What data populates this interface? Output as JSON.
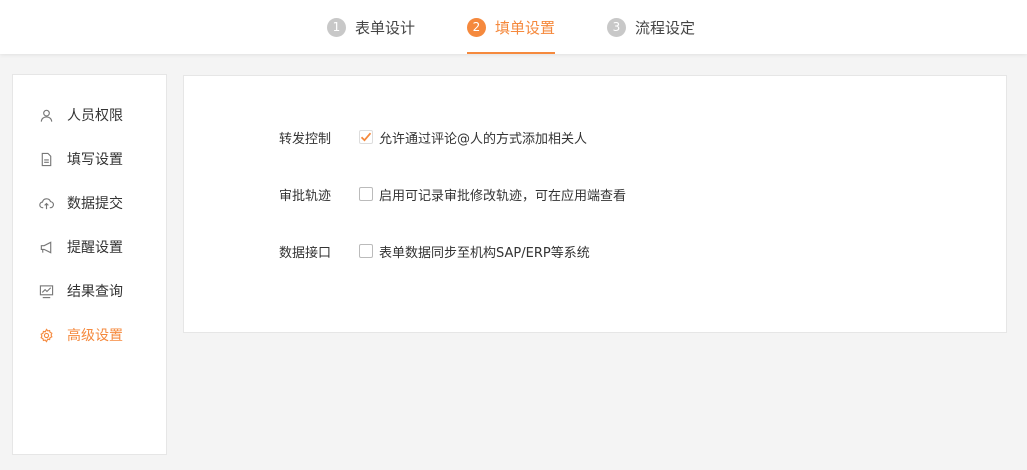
{
  "steps": [
    {
      "num": "1",
      "label": "表单设计",
      "active": false
    },
    {
      "num": "2",
      "label": "填单设置",
      "active": true
    },
    {
      "num": "3",
      "label": "流程设定",
      "active": false
    }
  ],
  "sidebar": {
    "items": [
      {
        "label": "人员权限",
        "icon": "user-icon"
      },
      {
        "label": "填写设置",
        "icon": "document-icon"
      },
      {
        "label": "数据提交",
        "icon": "cloud-upload-icon"
      },
      {
        "label": "提醒设置",
        "icon": "megaphone-icon"
      },
      {
        "label": "结果查询",
        "icon": "chart-monitor-icon"
      },
      {
        "label": "高级设置",
        "icon": "gear-icon",
        "active": true
      }
    ]
  },
  "settings": {
    "rows": [
      {
        "label": "转发控制",
        "text": "允许通过评论@人的方式添加相关人",
        "checked": true
      },
      {
        "label": "审批轨迹",
        "text": "启用可记录审批修改轨迹，可在应用端查看",
        "checked": false
      },
      {
        "label": "数据接口",
        "text": "表单数据同步至机构SAP/ERP等系统",
        "checked": false
      }
    ]
  },
  "colors": {
    "accent": "#f5893d",
    "inactive_step": "#c8c8c8",
    "background": "#f4f4f4"
  }
}
